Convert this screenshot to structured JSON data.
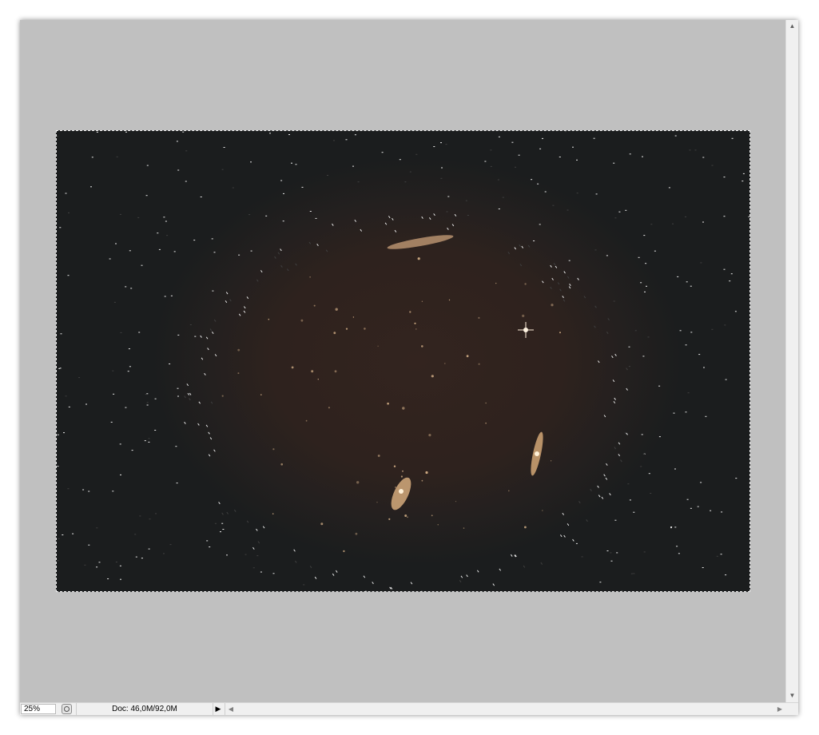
{
  "window": {
    "canvas_background": "#c0c0c0",
    "photo_background": "#2e221e"
  },
  "statusbar": {
    "zoom": "25%",
    "doc_info": "Doc: 46,0M/92,0M",
    "status_icon": "timer-icon",
    "menu_arrow_icon": "play-triangle-icon"
  },
  "scrollbars": {
    "up_icon": "scroll-up-arrow-icon",
    "down_icon": "scroll-down-arrow-icon",
    "left_icon": "scroll-left-arrow-icon",
    "right_icon": "scroll-right-arrow-icon"
  }
}
